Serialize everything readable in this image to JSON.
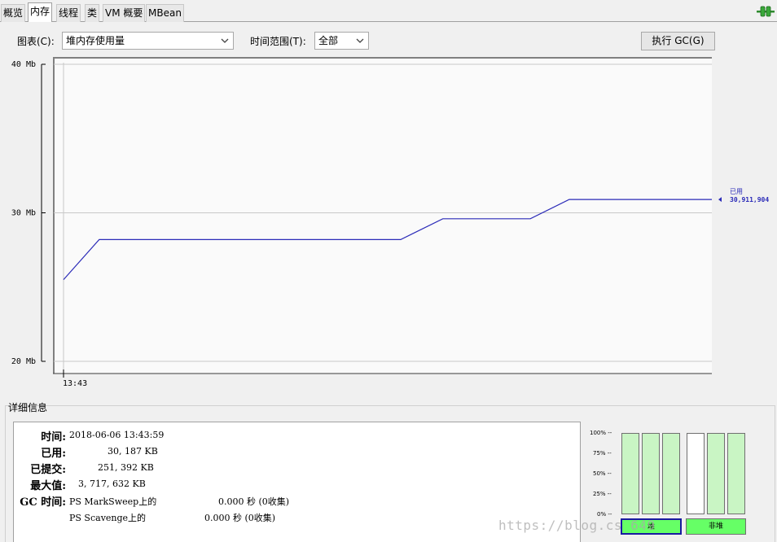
{
  "tabs": [
    {
      "label": "概览",
      "active": false
    },
    {
      "label": "内存",
      "active": true
    },
    {
      "label": "线程",
      "active": false
    },
    {
      "label": "类",
      "active": false
    },
    {
      "label": "VM 概要",
      "active": false
    },
    {
      "label": "MBean",
      "active": false
    }
  ],
  "controls": {
    "chart_label": "图表(C):",
    "chart_select": "堆内存使用量",
    "range_label": "时间范围(T):",
    "range_select": "全部",
    "gc_button": "执行 GC(G)"
  },
  "chart_data": {
    "type": "line",
    "y_unit": "Mb",
    "ylim": [
      20,
      40
    ],
    "y_ticks": [
      {
        "value": 40,
        "label": "40 Mb"
      },
      {
        "value": 30,
        "label": "30 Mb"
      },
      {
        "value": 20,
        "label": "20 Mb"
      }
    ],
    "x_tick_label": "13:43",
    "grid": true,
    "series": [
      {
        "name": "已用",
        "color": "#2b2bb8",
        "x": [
          0,
          0.055,
          0.52,
          0.585,
          0.72,
          0.78,
          1.0
        ],
        "y": [
          25.5,
          28.2,
          28.2,
          29.6,
          29.6,
          30.9,
          30.9
        ]
      }
    ],
    "current_label": "已用",
    "current_value": "30,911,904"
  },
  "details": {
    "title": "详细信息",
    "rows": [
      {
        "label": "时间:",
        "value": "2018-06-06 13:43:59"
      },
      {
        "label": "已用:",
        "value": "30, 187 KB"
      },
      {
        "label": "已提交:",
        "value": "251, 392 KB"
      },
      {
        "label": "最大值:",
        "value": "3, 717, 632 KB"
      },
      {
        "label": "GC 时间:",
        "value": "PS MarkSweep上的",
        "value2": "0.000 秒 (0收集)"
      }
    ],
    "extra_row": {
      "value": "PS Scavenge上的",
      "value2": "0.000 秒 (0收集)"
    }
  },
  "memory_bars": {
    "pct_labels": [
      "100% --",
      "75% --",
      "50% --",
      "25% --",
      "0% --"
    ],
    "heap_fills": [
      1.0,
      1.0,
      1.0
    ],
    "nonheap_fills": [
      0.0,
      1.0,
      1.0
    ],
    "heap_label": "堆",
    "nonheap_label": "非堆",
    "active_color": "#66ff66",
    "border_selected": "#1a1aa0"
  },
  "watermark": "https://blog.cs         649"
}
